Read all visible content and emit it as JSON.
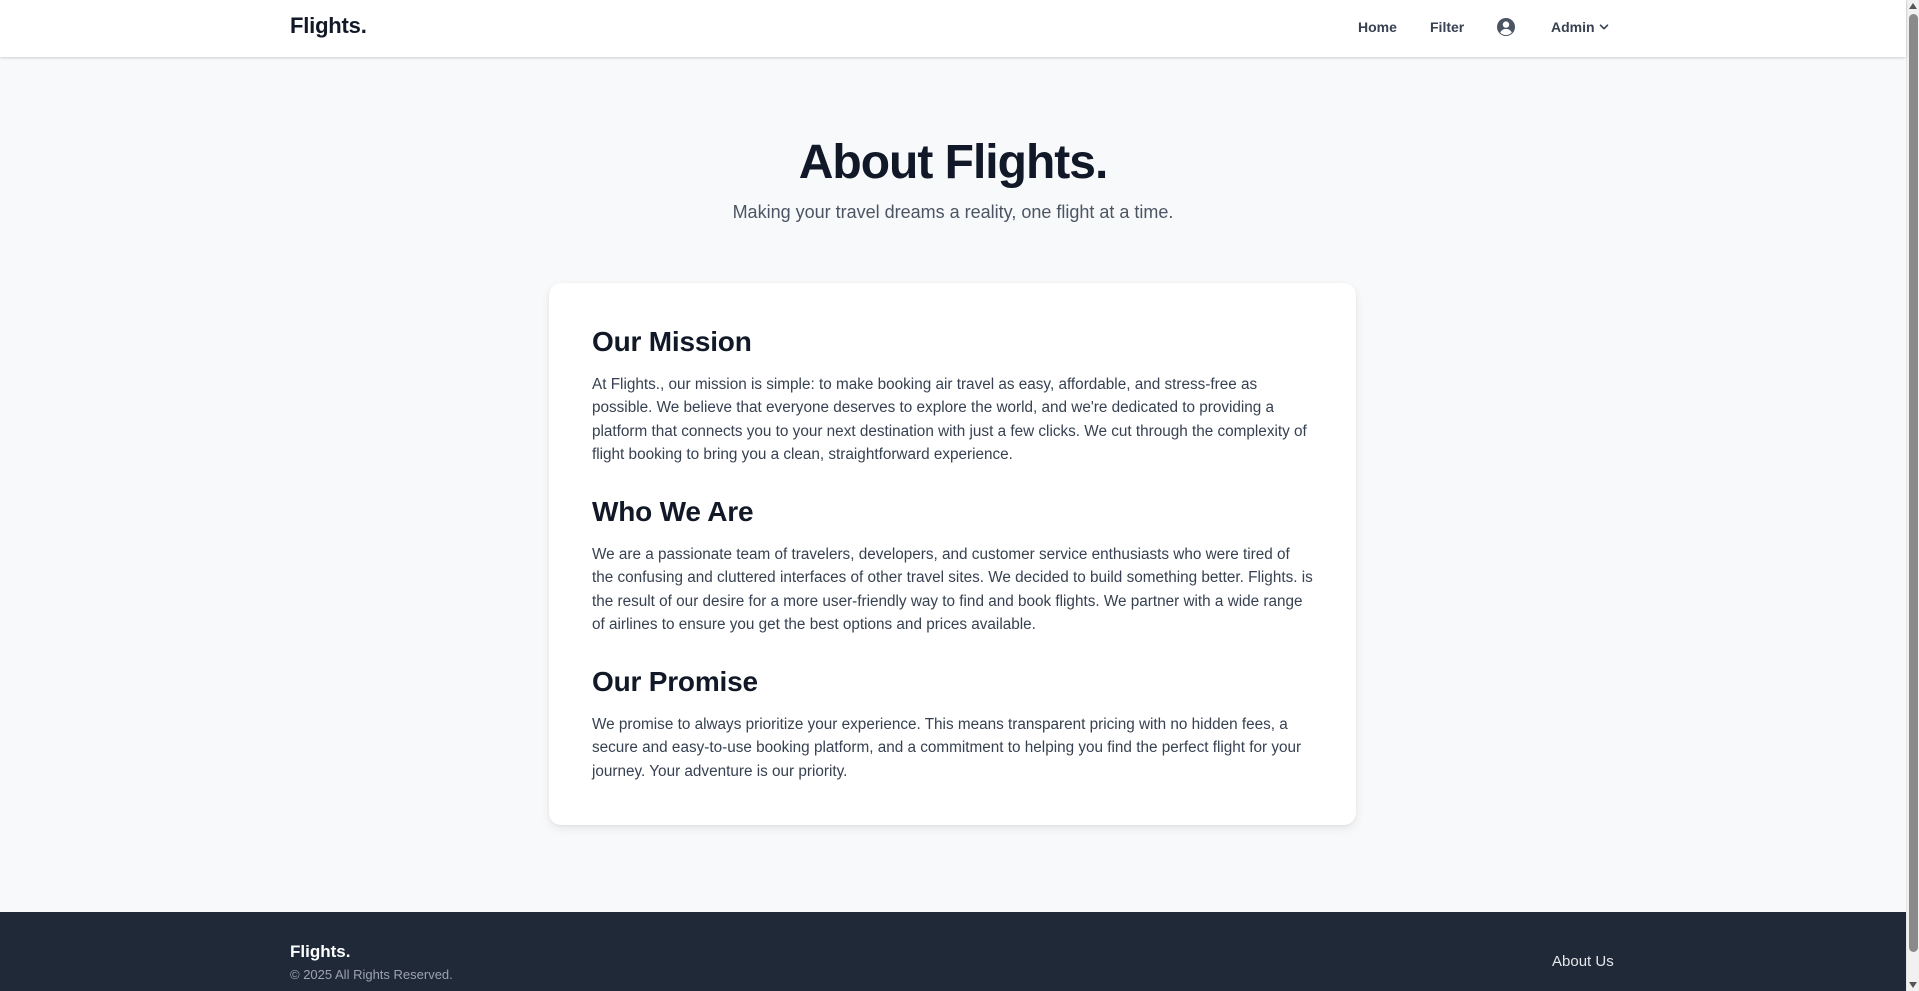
{
  "nav": {
    "brand": "Flights.",
    "home": "Home",
    "filter": "Filter",
    "user_menu": "Admin"
  },
  "hero": {
    "title": "About Flights.",
    "subtitle": "Making your travel dreams a reality, one flight at a time."
  },
  "sections": [
    {
      "heading": "Our Mission",
      "body": "At Flights., our mission is simple: to make booking air travel as easy, affordable, and stress-free as possible. We believe that everyone deserves to explore the world, and we're dedicated to providing a platform that connects you to your next destination with just a few clicks. We cut through the complexity of flight booking to bring you a clean, straightforward experience."
    },
    {
      "heading": "Who We Are",
      "body": "We are a passionate team of travelers, developers, and customer service enthusiasts who were tired of the confusing and cluttered interfaces of other travel sites. We decided to build something better. Flights. is the result of our desire for a more user-friendly way to find and book flights. We partner with a wide range of airlines to ensure you get the best options and prices available."
    },
    {
      "heading": "Our Promise",
      "body": "We promise to always prioritize your experience. This means transparent pricing with no hidden fees, a secure and easy-to-use booking platform, and a commitment to helping you find the perfect flight for your journey. Your adventure is our priority."
    }
  ],
  "footer": {
    "brand": "Flights.",
    "copyright": "© 2025 All Rights Reserved.",
    "about_link": "About Us"
  },
  "icons": {
    "user": "user-circle-icon",
    "chevron": "chevron-down-icon"
  },
  "colors": {
    "background": "#f8f9fb",
    "footer": "#1f2937",
    "heading": "#111827",
    "body_text": "#374151"
  }
}
